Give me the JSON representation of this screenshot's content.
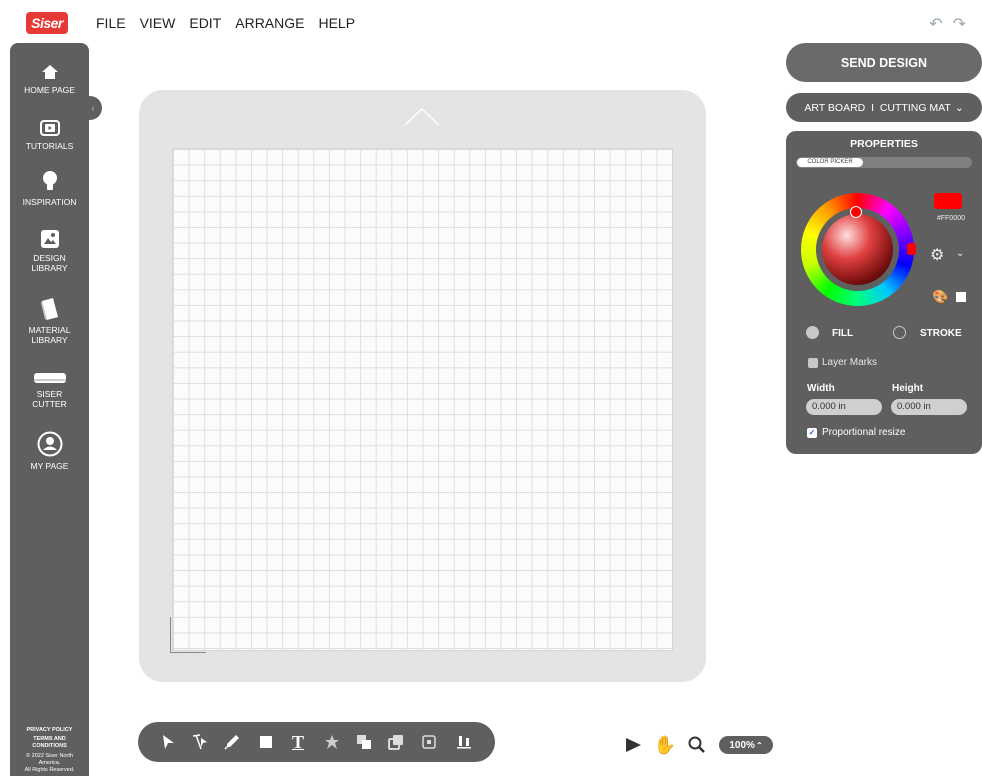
{
  "brand": {
    "logo_text": "Siser",
    "accent": "#e53935"
  },
  "menu": {
    "file": "FILE",
    "view": "VIEW",
    "edit": "EDIT",
    "arrange": "ARRANGE",
    "help": "HELP"
  },
  "sidebar": {
    "items": [
      {
        "label": "HOME PAGE",
        "icon": "home-icon"
      },
      {
        "label": "TUTORIALS",
        "icon": "video-icon"
      },
      {
        "label": "INSPIRATION",
        "icon": "lightbulb-icon"
      },
      {
        "label": "DESIGN\nLIBRARY",
        "icon": "image-icon"
      },
      {
        "label": "MATERIAL\nLIBRARY",
        "icon": "material-icon"
      },
      {
        "label": "SISER\nCUTTER",
        "icon": "cutter-icon"
      },
      {
        "label": "MY PAGE",
        "icon": "user-icon"
      }
    ],
    "footer": {
      "privacy": "PRIVACY POLICY",
      "terms": "TERMS AND\nCONDITIONS",
      "copyright": "© 2022 Siser North\nAmerica.\nAll Rights Reserved."
    }
  },
  "right_panel": {
    "send_design": "SEND DESIGN",
    "artboard_select": "ART BOARD  I  CUTTING MAT",
    "properties": {
      "title": "PROPERTIES",
      "color_picker_tab": "COLOR PICKER",
      "selected_color": "#FF0000",
      "hex_label": "#FF0000",
      "fill_label": "FILL",
      "stroke_label": "STROKE",
      "layer_marks_label": "Layer Marks",
      "width_label": "Width",
      "height_label": "Height",
      "width_value": "0.000 in",
      "height_value": "0.000 in",
      "proportional_label": "Proportional resize",
      "proportional_checked": true
    }
  },
  "view_controls": {
    "zoom": "100%"
  }
}
